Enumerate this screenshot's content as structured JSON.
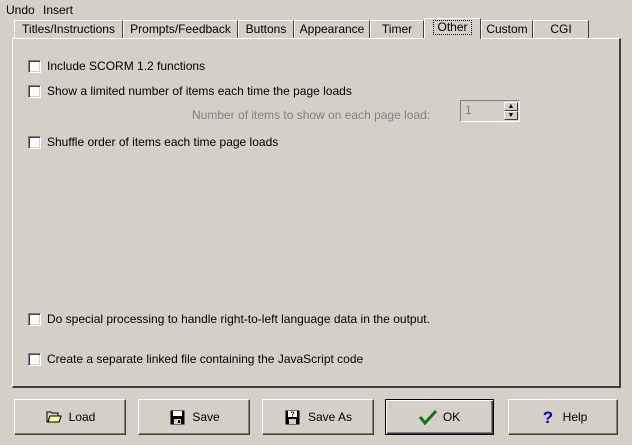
{
  "menubar": {
    "undo_label": "Undo",
    "insert_label": "Insert"
  },
  "tabs": [
    {
      "label": "Titles/Instructions",
      "active": false
    },
    {
      "label": "Prompts/Feedback",
      "active": false
    },
    {
      "label": "Buttons",
      "active": false
    },
    {
      "label": "Appearance",
      "active": false
    },
    {
      "label": "Timer",
      "active": false
    },
    {
      "label": "Other",
      "active": true
    },
    {
      "label": "Custom",
      "active": false
    },
    {
      "label": "CGI",
      "active": false
    }
  ],
  "options": {
    "scorm": {
      "label": "Include SCORM 1.2 functions",
      "checked": false
    },
    "limit_items": {
      "label": "Show a limited number of items each time the page loads",
      "checked": false
    },
    "num_items_label": "Number of items to show on each page load:",
    "num_items_value": "1",
    "shuffle": {
      "label": "Shuffle order of items each time page loads",
      "checked": false
    },
    "rtl": {
      "label": "Do special processing to handle right-to-left language data in the output.",
      "checked": false
    },
    "separate_js": {
      "label": "Create a separate linked file containing the JavaScript code",
      "checked": false
    }
  },
  "buttons": {
    "load": {
      "label": "Load",
      "icon": "folder-icon"
    },
    "save": {
      "label": "Save",
      "icon": "floppy-disk-icon"
    },
    "save_as": {
      "label": "Save As",
      "icon": "floppy-disk-question-icon"
    },
    "ok": {
      "label": "OK",
      "icon": "checkmark-icon"
    },
    "help": {
      "label": "Help",
      "icon": "question-mark-icon"
    }
  },
  "colors": {
    "face": "#d4d0c8",
    "disabled_text": "#808080",
    "ok_check": "#008000",
    "help_icon": "#0000cc"
  }
}
